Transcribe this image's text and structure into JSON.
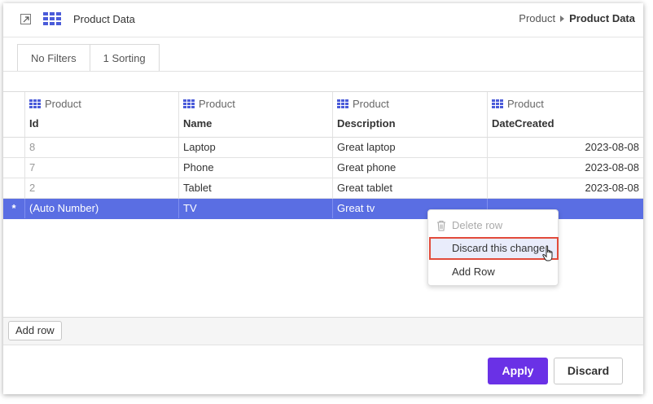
{
  "header": {
    "title": "Product Data",
    "breadcrumb": [
      "Product",
      "Product Data"
    ]
  },
  "filters": {
    "tabs": [
      "No Filters",
      "1 Sorting"
    ]
  },
  "grid": {
    "columns": [
      {
        "table": "Product",
        "name": "Id"
      },
      {
        "table": "Product",
        "name": "Name"
      },
      {
        "table": "Product",
        "name": "Description"
      },
      {
        "table": "Product",
        "name": "DateCreated"
      }
    ],
    "rows": [
      {
        "id": "8",
        "name": "Laptop",
        "description": "Great laptop",
        "date": "2023-08-08"
      },
      {
        "id": "7",
        "name": "Phone",
        "description": "Great phone",
        "date": "2023-08-08"
      },
      {
        "id": "2",
        "name": "Tablet",
        "description": "Great tablet",
        "date": "2023-08-08"
      }
    ],
    "new_row": {
      "marker": "*",
      "id": "(Auto Number)",
      "name": "TV",
      "description": "Great tv",
      "date": ""
    },
    "add_row_label": "Add row"
  },
  "context_menu": {
    "items": [
      "Delete row",
      "Discard this change",
      "Add Row"
    ]
  },
  "actions": {
    "apply": "Apply",
    "discard": "Discard"
  },
  "colors": {
    "accent": "#6a31e6",
    "selected_row": "#5a6ee3",
    "highlight_border": "#e24b3b",
    "grid_icon": "#4a5bd9"
  }
}
